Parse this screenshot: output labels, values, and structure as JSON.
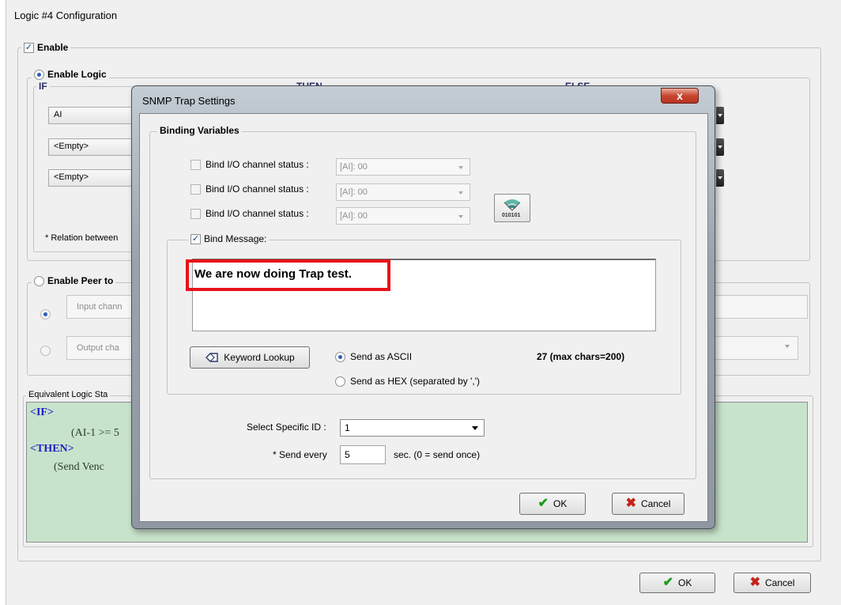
{
  "window": {
    "title": "Logic #4 Configuration"
  },
  "enable": {
    "label": "Enable",
    "checked": true
  },
  "enable_logic": {
    "label": "Enable Logic",
    "if_label": "IF",
    "then_label": "THEN",
    "else_label": "ELSE",
    "conditions": [
      "AI",
      "<Empty>",
      "<Empty>"
    ],
    "relation_note": "* Relation between"
  },
  "peer": {
    "label": "Enable Peer to",
    "input_channel": "Input chann",
    "output_channel": "Output cha"
  },
  "equivalent": {
    "label": "Equivalent Logic Sta",
    "if_tag": "<IF>",
    "cond": "(AI-1 >= 5",
    "then_tag": "<THEN>",
    "action": "(Send Venc"
  },
  "main_buttons": {
    "ok": "OK",
    "cancel": "Cancel"
  },
  "dialog": {
    "title": "SNMP Trap Settings",
    "close_glyph": "x",
    "binding_label": "Binding Variables",
    "bind_rows": [
      {
        "label": "Bind I/O channel status :",
        "value": "[AI]: 00",
        "checked": false
      },
      {
        "label": "Bind I/O channel status :",
        "value": "[AI]: 00",
        "checked": false
      },
      {
        "label": "Bind I/O channel status :",
        "value": "[AI]: 00",
        "checked": false
      }
    ],
    "bind_icon_text": "010101",
    "bind_message": {
      "label": "Bind Message:",
      "checked": true
    },
    "message": "We are now doing Trap test.",
    "keyword_lookup": "Keyword Lookup",
    "send_ascii": "Send as ASCII",
    "send_hex": "Send as HEX (separated by ',')",
    "char_count": "27 (max chars=200)",
    "specific_id_label": "Select Specific ID :",
    "specific_id_value": "1",
    "send_every_label": "* Send every",
    "send_every_value": "5",
    "send_every_unit": "sec. (0 = send once)",
    "ok": "OK",
    "cancel": "Cancel"
  }
}
